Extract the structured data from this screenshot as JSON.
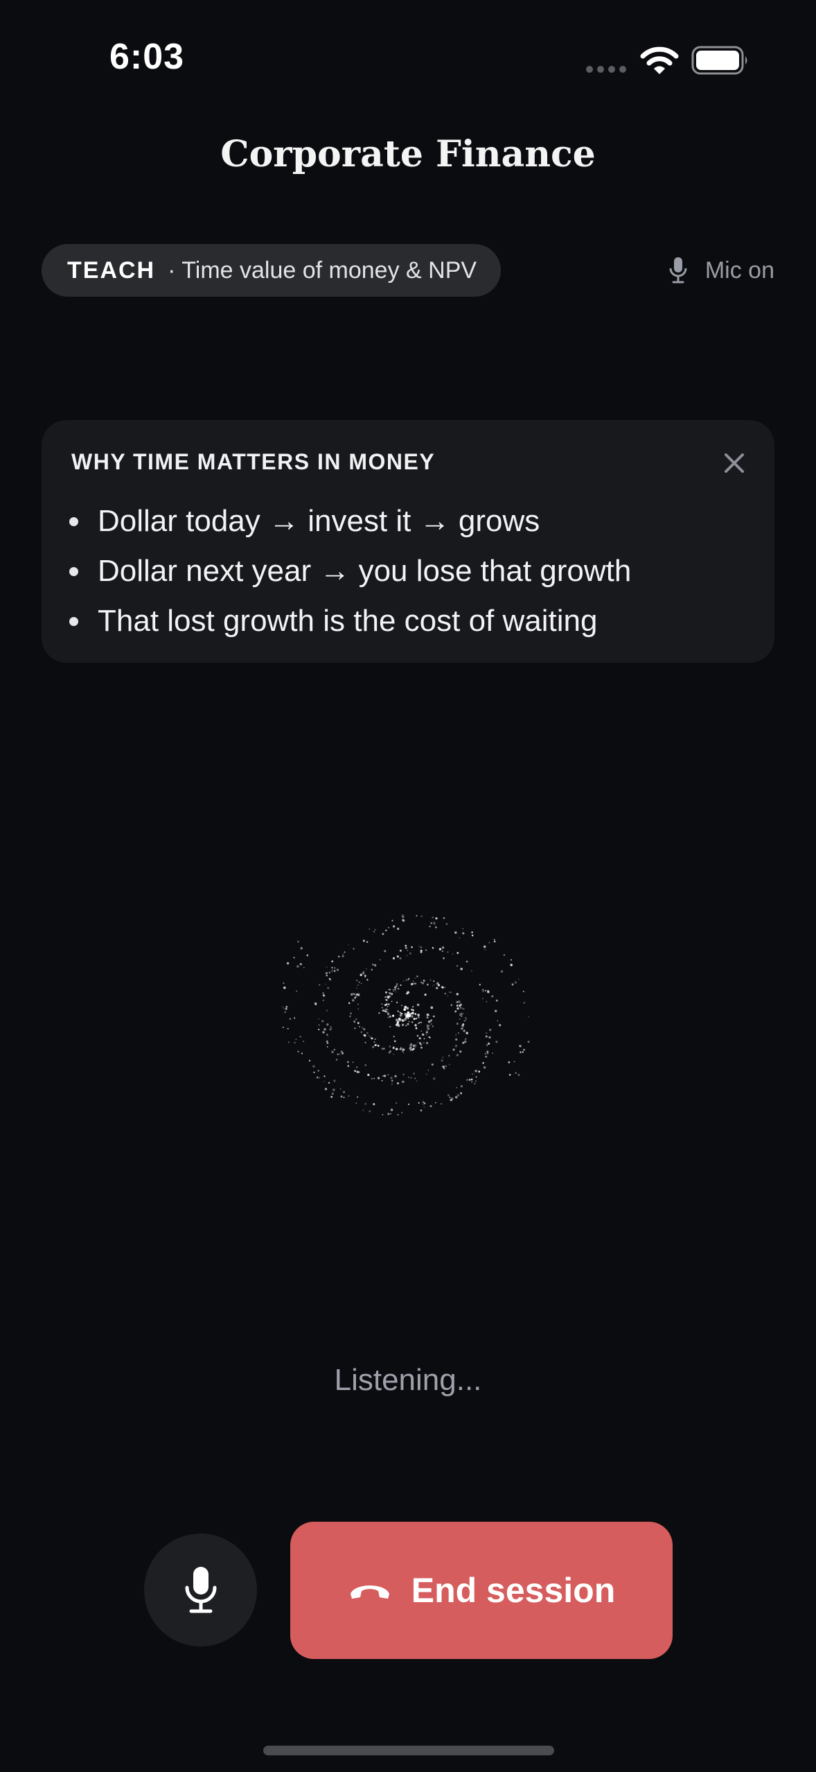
{
  "status_bar": {
    "time": "6:03",
    "icons": [
      "signal-dots-icon",
      "wifi-icon",
      "battery-icon"
    ]
  },
  "header": {
    "title": "Corporate Finance"
  },
  "mode": {
    "tag": "TEACH",
    "topic": "· Time value of money & NPV"
  },
  "mic_status": {
    "label": "Mic on",
    "icon": "microphone-icon"
  },
  "card": {
    "title": "WHY TIME MATTERS IN MONEY",
    "close_icon": "close-icon",
    "items": [
      "Dollar today → invest it → grows",
      "Dollar next year → you lose that growth",
      "That lost growth is the cost of waiting"
    ]
  },
  "visualizer": {
    "icon": "galaxy-spiral-visualizer"
  },
  "listening": {
    "label": "Listening..."
  },
  "controls": {
    "mic_icon": "microphone-icon",
    "end_label": "End session",
    "end_icon": "phone-hangup-icon"
  },
  "colors": {
    "background": "#0b0c0f",
    "card": "#17191d",
    "pill": "#2a2b2f",
    "end_button": "#d65d5e",
    "muted_text": "#9ea1ab"
  }
}
